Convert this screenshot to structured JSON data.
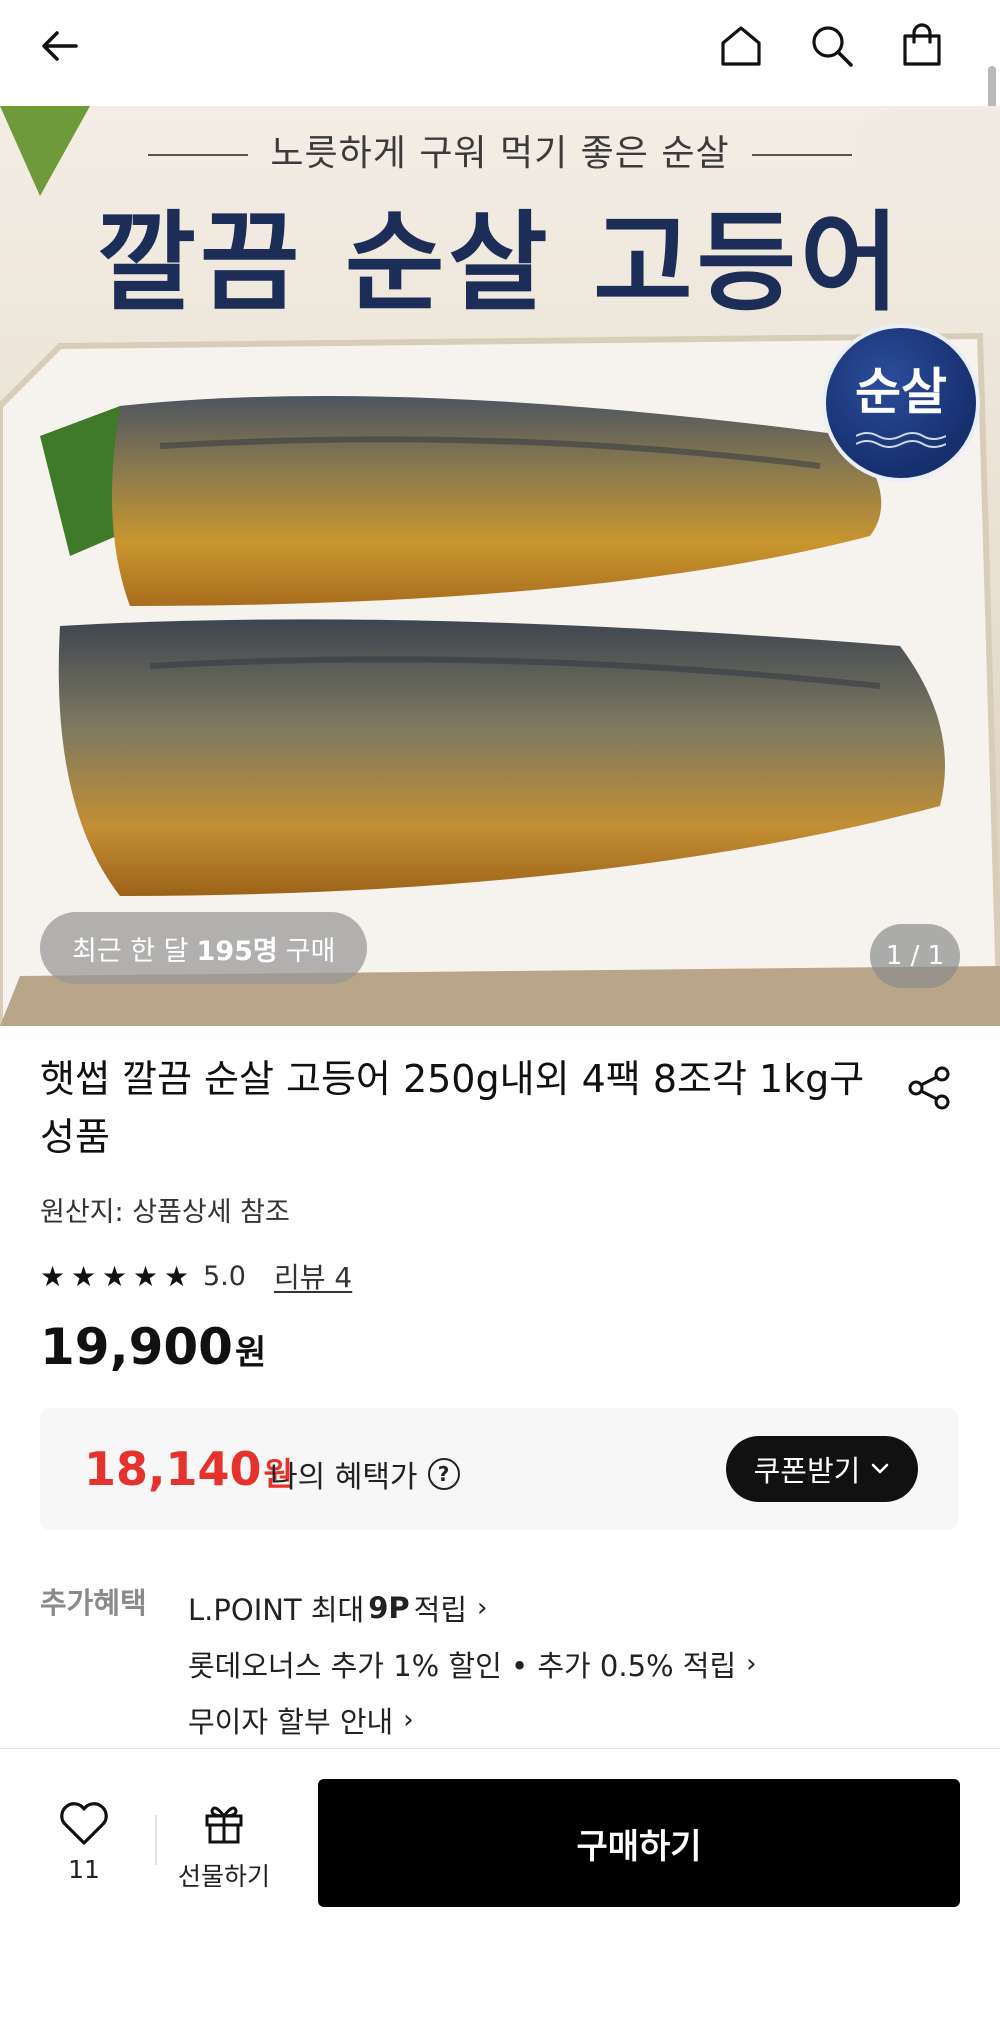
{
  "header": {
    "back_icon": "arrow-left-icon",
    "home_icon": "home-icon",
    "search_icon": "search-icon",
    "cart_icon": "shopping-bag-icon"
  },
  "hero": {
    "subtitle": "노릇하게 구워 먹기 좋은 순살",
    "title": "깔끔 순살 고등어",
    "badge": "순살",
    "buyers_prefix": "최근 한 달",
    "buyers_count": "195명",
    "buyers_suffix": "구매",
    "counter": "1 / 1"
  },
  "product": {
    "title": "햇썹 깔끔 순살 고등어 250g내외 4팩 8조각 1kg구성품",
    "origin": "원산지: 상품상세 참조",
    "rating": "5.0",
    "stars": 5,
    "review_link": "리뷰 4",
    "price": "19,900",
    "price_unit": "원"
  },
  "benefit": {
    "price": "18,140",
    "price_unit": "원",
    "label": "나의 혜택가",
    "help_symbol": "?",
    "coupon_label": "쿠폰받기",
    "accent_color": "#e5322d"
  },
  "extra": {
    "label": "추가혜택",
    "items": [
      {
        "pre": "L.POINT 최대 ",
        "bold": "9P",
        "post": " 적립"
      },
      {
        "pre": "롯데오너스 추가 1% 할인 • 추가 0.5% 적립",
        "bold": "",
        "post": ""
      },
      {
        "pre": "무이자 할부 안내",
        "bold": "",
        "post": ""
      }
    ],
    "chevron": "›"
  },
  "bottom": {
    "like_count": "11",
    "gift_label": "선물하기",
    "buy_label": "구매하기"
  }
}
